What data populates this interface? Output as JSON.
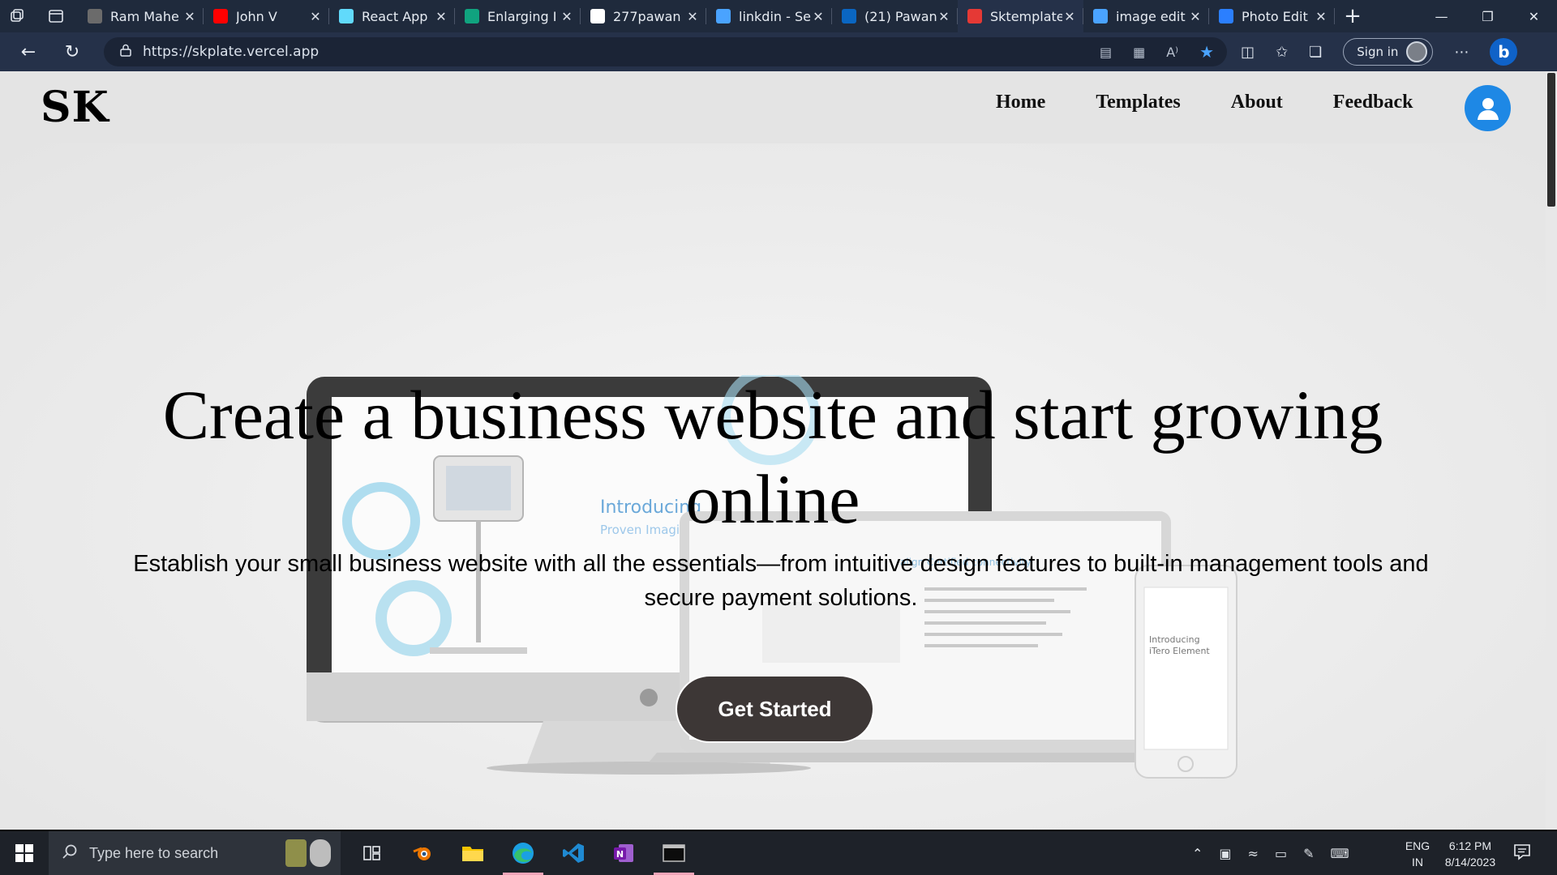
{
  "browser": {
    "tabs": [
      {
        "label": "Ram Mahe",
        "icon": "ram-mahe-favicon",
        "color": "#6b6b6b"
      },
      {
        "label": "John V",
        "icon": "youtube-favicon",
        "color": "#ff0000"
      },
      {
        "label": "React App",
        "icon": "react-favicon",
        "color": "#61dafb"
      },
      {
        "label": "Enlarging I",
        "icon": "chatgpt-favicon",
        "color": "#10a37f"
      },
      {
        "label": "277pawan",
        "icon": "github-favicon",
        "color": "#ffffff"
      },
      {
        "label": "linkdin - Se",
        "icon": "search-favicon",
        "color": "#4aa3ff"
      },
      {
        "label": "(21) Pawan",
        "icon": "linkedin-favicon",
        "color": "#0a66c2"
      },
      {
        "label": "Sktemplate",
        "icon": "sktemplate-favicon",
        "color": "#e53935"
      },
      {
        "label": "image edit",
        "icon": "search-favicon",
        "color": "#4aa3ff"
      },
      {
        "label": "Photo Edit",
        "icon": "photo-edit-favicon",
        "color": "#2b7fff"
      }
    ],
    "active_tab_index": 7,
    "url": "https://skplate.vercel.app",
    "sign_in_label": "Sign in"
  },
  "site": {
    "logo": "SK",
    "nav": [
      "Home",
      "Templates",
      "About",
      "Feedback"
    ],
    "hero": {
      "headline": "Create a business website and start growing online",
      "subline": "Establish your small business website with all the essentials—from intuitive design features to built-in management tools and secure payment solutions.",
      "cta_label": "Get Started"
    },
    "colors": {
      "accent": "#1e88e5",
      "cta": "#3d3736"
    }
  },
  "taskbar": {
    "search_placeholder": "Type here to search",
    "lang_line1": "ENG",
    "lang_line2": "IN",
    "time": "6:12 PM",
    "date": "8/14/2023"
  }
}
